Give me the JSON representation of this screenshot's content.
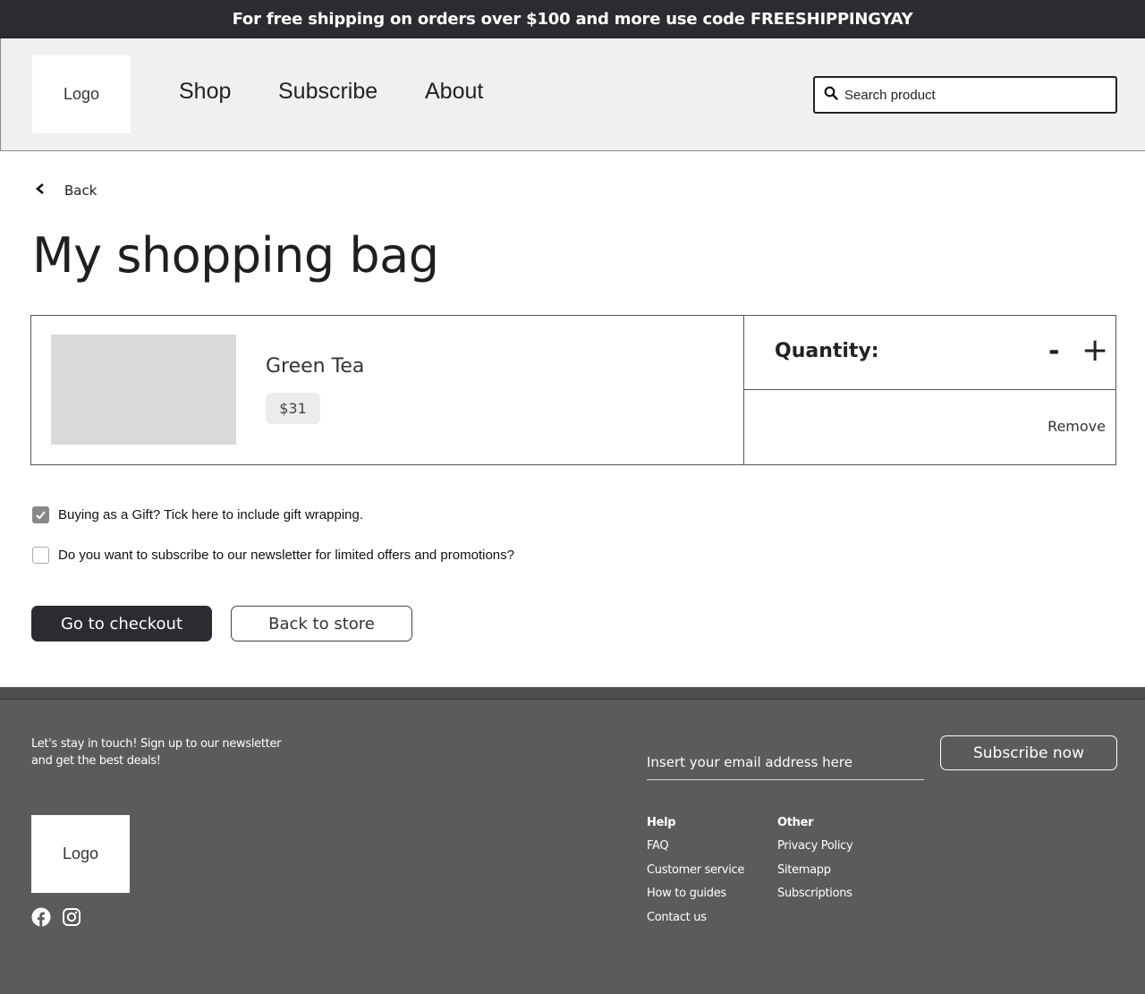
{
  "promo": {
    "text": "For free shipping on orders over $100 and more use code FREESHIPPINGYAY"
  },
  "header": {
    "logo": "Logo",
    "nav": {
      "shop": "Shop",
      "subscribe": "Subscribe",
      "about": "About"
    },
    "search": {
      "placeholder": "Search product",
      "icon": "search-icon"
    }
  },
  "back": {
    "label": "Back",
    "icon": "chevron-left-icon"
  },
  "page_title": "My shopping bag",
  "bag": {
    "items": [
      {
        "name": "Green Tea",
        "price": "$31",
        "quantity_label": "Quantity:",
        "minus": "-",
        "plus": "+",
        "remove": "Remove"
      }
    ]
  },
  "options": {
    "gift": {
      "label": "Buying as a Gift? Tick here to include gift wrapping.",
      "checked": true
    },
    "newsletter": {
      "label": "Do you want to subscribe to our newsletter for limited offers and promotions?",
      "checked": false
    }
  },
  "actions": {
    "checkout": "Go to checkout",
    "back_to_store": "Back to store"
  },
  "footer": {
    "newsletter_text": "Let's stay in touch! Sign up to our newsletter and get the best deals!",
    "email_placeholder": "Insert your email address here",
    "subscribe_button": "Subscribe now",
    "logo": "Logo",
    "social": [
      "facebook-icon",
      "instagram-icon"
    ],
    "help": {
      "heading": "Help",
      "links": [
        "FAQ",
        "Customer service",
        "How to guides",
        "Contact us"
      ]
    },
    "other": {
      "heading": "Other",
      "links": [
        "Privacy Policy",
        "Sitemapp",
        "Subscriptions"
      ]
    }
  },
  "colors": {
    "dark": "#2b2c30",
    "footer_bg": "#5b5b5b",
    "header_bg": "#f0f0f2",
    "thumb": "#d9d9d9"
  }
}
